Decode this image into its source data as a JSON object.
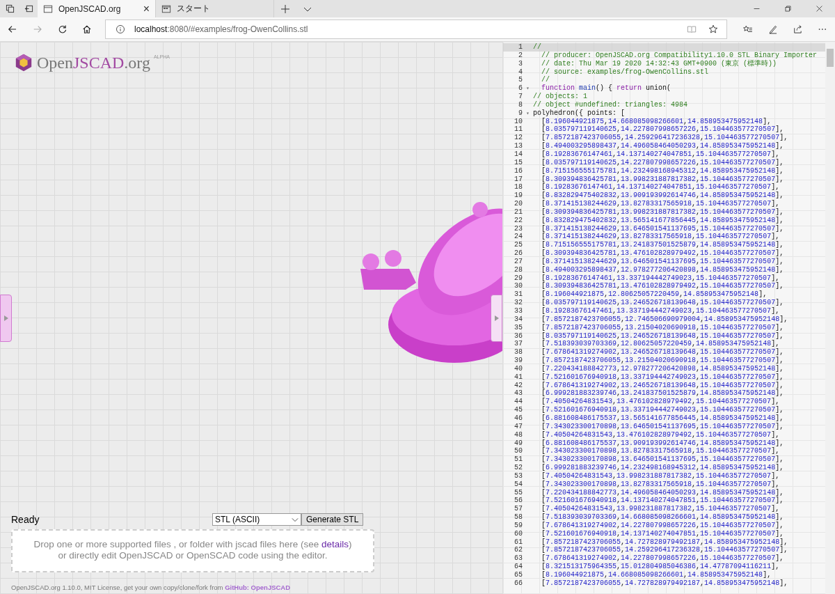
{
  "browser": {
    "tabs": [
      {
        "title": "OpenJSCAD.org",
        "selected": true,
        "close": "×"
      },
      {
        "title": "スタート",
        "selected": false
      }
    ],
    "address": {
      "host": "localhost",
      "path": ":8080/#examples/frog-OwenCollins.stl"
    }
  },
  "app": {
    "logo": {
      "plain": "Open",
      "accent": "JSCAD",
      "suffix": ".org",
      "badge": "ALPHA"
    },
    "status": "Ready",
    "format_select": "STL (ASCII)",
    "generate_button": "Generate STL",
    "drop_zone": {
      "text": "Drop one or more supported files , or folder with jscad files here (see ",
      "link": "details",
      "text_end": ")",
      "line2": "or directly edit OpenJSCAD or OpenSCAD code using the editor."
    },
    "footer": {
      "text": "OpenJSCAD.org 1.10.0, MIT License, get your own copy/clone/fork from ",
      "link": "GitHub: OpenJSCAD"
    }
  },
  "editor": {
    "lines": [
      {
        "n": "1",
        "kind": "comment",
        "active": true,
        "text": "//"
      },
      {
        "n": "2",
        "kind": "comment",
        "active": false,
        "text": "  // producer: OpenJSCAD.org Compatibility1.10.0 STL Binary Importer"
      },
      {
        "n": "3",
        "kind": "comment",
        "active": false,
        "text": "  // date: Thu Mar 19 2020 14:32:43 GMT+0900 (東京 (標準時))"
      },
      {
        "n": "4",
        "kind": "comment",
        "active": false,
        "text": "  // source: examples/frog-OwenCollins.stl"
      },
      {
        "n": "5",
        "kind": "comment",
        "active": false,
        "text": "  //"
      },
      {
        "n": "6",
        "kind": "code",
        "active": false,
        "fold": "▾",
        "parts": [
          {
            "kind": "keyword",
            "text": "  function "
          },
          {
            "kind": "def",
            "text": "main"
          },
          {
            "kind": "plain",
            "text": "() { "
          },
          {
            "kind": "keyword",
            "text": "return "
          },
          {
            "kind": "plain",
            "text": "union("
          }
        ]
      },
      {
        "n": "7",
        "kind": "comment",
        "active": false,
        "text": "// objects: 1"
      },
      {
        "n": "8",
        "kind": "comment",
        "active": false,
        "text": "// object #undefined: triangles: 4984"
      },
      {
        "n": "9",
        "kind": "code",
        "active": false,
        "fold": "▾",
        "parts": [
          {
            "kind": "plain",
            "text": "polyhedron({ points: ["
          }
        ]
      },
      {
        "n": "10",
        "kind": "point",
        "active": false,
        "text": "  [8.196044921875,14.668085098266601,14.858953475952148],"
      },
      {
        "n": "11",
        "kind": "point",
        "active": false,
        "text": "  [8.035797119140625,14.227807998657226,15.104463577270507],"
      },
      {
        "n": "12",
        "kind": "point",
        "active": false,
        "text": "  [7.8572187423706055,14.259296417236328,15.104463577270507],"
      },
      {
        "n": "13",
        "kind": "point",
        "active": false,
        "text": "  [8.494003295898437,14.496058464050293,14.858953475952148],"
      },
      {
        "n": "14",
        "kind": "point",
        "active": false,
        "text": "  [8.19283676147461,14.137140274047851,15.104463577270507],"
      },
      {
        "n": "15",
        "kind": "point",
        "active": false,
        "text": "  [8.035797119140625,14.227807998657226,15.104463577270507],"
      },
      {
        "n": "16",
        "kind": "point",
        "active": false,
        "text": "  [8.715156555175781,14.232498168945312,14.858953475952148],"
      },
      {
        "n": "17",
        "kind": "point",
        "active": false,
        "text": "  [8.309394836425781,13.998231887817382,15.104463577270507],"
      },
      {
        "n": "18",
        "kind": "point",
        "active": false,
        "text": "  [8.19283676147461,14.137140274047851,15.104463577270507],"
      },
      {
        "n": "19",
        "kind": "point",
        "active": false,
        "text": "  [8.832829475402832,13.909193992614746,14.858953475952148],"
      },
      {
        "n": "20",
        "kind": "point",
        "active": false,
        "text": "  [8.371415138244629,13.82783317565918,15.104463577270507],"
      },
      {
        "n": "21",
        "kind": "point",
        "active": false,
        "text": "  [8.309394836425781,13.998231887817382,15.104463577270507],"
      },
      {
        "n": "22",
        "kind": "point",
        "active": false,
        "text": "  [8.832829475402832,13.565141677856445,14.858953475952148],"
      },
      {
        "n": "23",
        "kind": "point",
        "active": false,
        "text": "  [8.371415138244629,13.646501541137695,15.104463577270507],"
      },
      {
        "n": "24",
        "kind": "point",
        "active": false,
        "text": "  [8.371415138244629,13.82783317565918,15.104463577270507],"
      },
      {
        "n": "25",
        "kind": "point",
        "active": false,
        "text": "  [8.715156555175781,13.241837501525879,14.858953475952148],"
      },
      {
        "n": "26",
        "kind": "point",
        "active": false,
        "text": "  [8.309394836425781,13.476102828979492,15.104463577270507],"
      },
      {
        "n": "27",
        "kind": "point",
        "active": false,
        "text": "  [8.371415138244629,13.646501541137695,15.104463577270507],"
      },
      {
        "n": "28",
        "kind": "point",
        "active": false,
        "text": "  [8.494003295898437,12.978277206420898,14.858953475952148],"
      },
      {
        "n": "29",
        "kind": "point",
        "active": false,
        "text": "  [8.19283676147461,13.337194442749023,15.104463577270507],"
      },
      {
        "n": "30",
        "kind": "point",
        "active": false,
        "text": "  [8.309394836425781,13.476102828979492,15.104463577270507],"
      },
      {
        "n": "31",
        "kind": "point",
        "active": false,
        "text": "  [8.196044921875,12.80625057220459,14.858953475952148],"
      },
      {
        "n": "32",
        "kind": "point",
        "active": false,
        "text": "  [8.035797119140625,13.246526718139648,15.104463577270507],"
      },
      {
        "n": "33",
        "kind": "point",
        "active": false,
        "text": "  [8.19283676147461,13.337194442749023,15.104463577270507],"
      },
      {
        "n": "34",
        "kind": "point",
        "active": false,
        "text": "  [7.8572187423706055,12.746506690979004,14.858953475952148],"
      },
      {
        "n": "35",
        "kind": "point",
        "active": false,
        "text": "  [7.8572187423706055,13.21504020690918,15.104463577270507],"
      },
      {
        "n": "36",
        "kind": "point",
        "active": false,
        "text": "  [8.035797119140625,13.246526718139648,15.104463577270507],"
      },
      {
        "n": "37",
        "kind": "point",
        "active": false,
        "text": "  [7.518393039703369,12.80625057220459,14.858953475952148],"
      },
      {
        "n": "38",
        "kind": "point",
        "active": false,
        "text": "  [7.678641319274902,13.246526718139648,15.104463577270507],"
      },
      {
        "n": "39",
        "kind": "point",
        "active": false,
        "text": "  [7.8572187423706055,13.21504020690918,15.104463577270507],"
      },
      {
        "n": "40",
        "kind": "point",
        "active": false,
        "text": "  [7.220434188842773,12.978277206420898,14.858953475952148],"
      },
      {
        "n": "41",
        "kind": "point",
        "active": false,
        "text": "  [7.521601676940918,13.337194442749023,15.104463577270507],"
      },
      {
        "n": "42",
        "kind": "point",
        "active": false,
        "text": "  [7.678641319274902,13.246526718139648,15.104463577270507],"
      },
      {
        "n": "43",
        "kind": "point",
        "active": false,
        "text": "  [6.999281883239746,13.241837501525879,14.858953475952148],"
      },
      {
        "n": "44",
        "kind": "point",
        "active": false,
        "text": "  [7.40504264831543,13.476102828979492,15.104463577270507],"
      },
      {
        "n": "45",
        "kind": "point",
        "active": false,
        "text": "  [7.521601676940918,13.337194442749023,15.104463577270507],"
      },
      {
        "n": "46",
        "kind": "point",
        "active": false,
        "text": "  [6.881608486175537,13.565141677856445,14.858953475952148],"
      },
      {
        "n": "47",
        "kind": "point",
        "active": false,
        "text": "  [7.343023300170898,13.646501541137695,15.104463577270507],"
      },
      {
        "n": "48",
        "kind": "point",
        "active": false,
        "text": "  [7.40504264831543,13.476102828979492,15.104463577270507],"
      },
      {
        "n": "49",
        "kind": "point",
        "active": false,
        "text": "  [6.881608486175537,13.909193992614746,14.858953475952148],"
      },
      {
        "n": "50",
        "kind": "point",
        "active": false,
        "text": "  [7.343023300170898,13.82783317565918,15.104463577270507],"
      },
      {
        "n": "51",
        "kind": "point",
        "active": false,
        "text": "  [7.343023300170898,13.646501541137695,15.104463577270507],"
      },
      {
        "n": "52",
        "kind": "point",
        "active": false,
        "text": "  [6.999281883239746,14.232498168945312,14.858953475952148],"
      },
      {
        "n": "53",
        "kind": "point",
        "active": false,
        "text": "  [7.40504264831543,13.998231887817382,15.104463577270507],"
      },
      {
        "n": "54",
        "kind": "point",
        "active": false,
        "text": "  [7.343023300170898,13.82783317565918,15.104463577270507],"
      },
      {
        "n": "55",
        "kind": "point",
        "active": false,
        "text": "  [7.220434188842773,14.496058464050293,14.858953475952148],"
      },
      {
        "n": "56",
        "kind": "point",
        "active": false,
        "text": "  [7.521601676940918,14.137140274047851,15.104463577270507],"
      },
      {
        "n": "57",
        "kind": "point",
        "active": false,
        "text": "  [7.40504264831543,13.998231887817382,15.104463577270507],"
      },
      {
        "n": "58",
        "kind": "point",
        "active": false,
        "text": "  [7.518393039703369,14.668085098266601,14.858953475952148],"
      },
      {
        "n": "59",
        "kind": "point",
        "active": false,
        "text": "  [7.678641319274902,14.227807998657226,15.104463577270507],"
      },
      {
        "n": "60",
        "kind": "point",
        "active": false,
        "text": "  [7.521601676940918,14.137140274047851,15.104463577270507],"
      },
      {
        "n": "61",
        "kind": "point",
        "active": false,
        "text": "  [7.8572187423706055,14.727828979492187,14.858953475952148],"
      },
      {
        "n": "62",
        "kind": "point",
        "active": false,
        "text": "  [7.8572187423706055,14.259296417236328,15.104463577270507],"
      },
      {
        "n": "63",
        "kind": "point",
        "active": false,
        "text": "  [7.678641319274902,14.227807998657226,15.104463577270507],"
      },
      {
        "n": "64",
        "kind": "point",
        "active": false,
        "text": "  [8.321513175964355,15.012804985046386,14.47787094116211],"
      },
      {
        "n": "65",
        "kind": "point",
        "active": false,
        "text": "  [8.196044921875,14.668085098266601,14.858953475952148],"
      },
      {
        "n": "66",
        "kind": "point",
        "active": false,
        "text": "  [7.8572187423706055,14.727828979492187,14.858953475952148],"
      }
    ]
  }
}
